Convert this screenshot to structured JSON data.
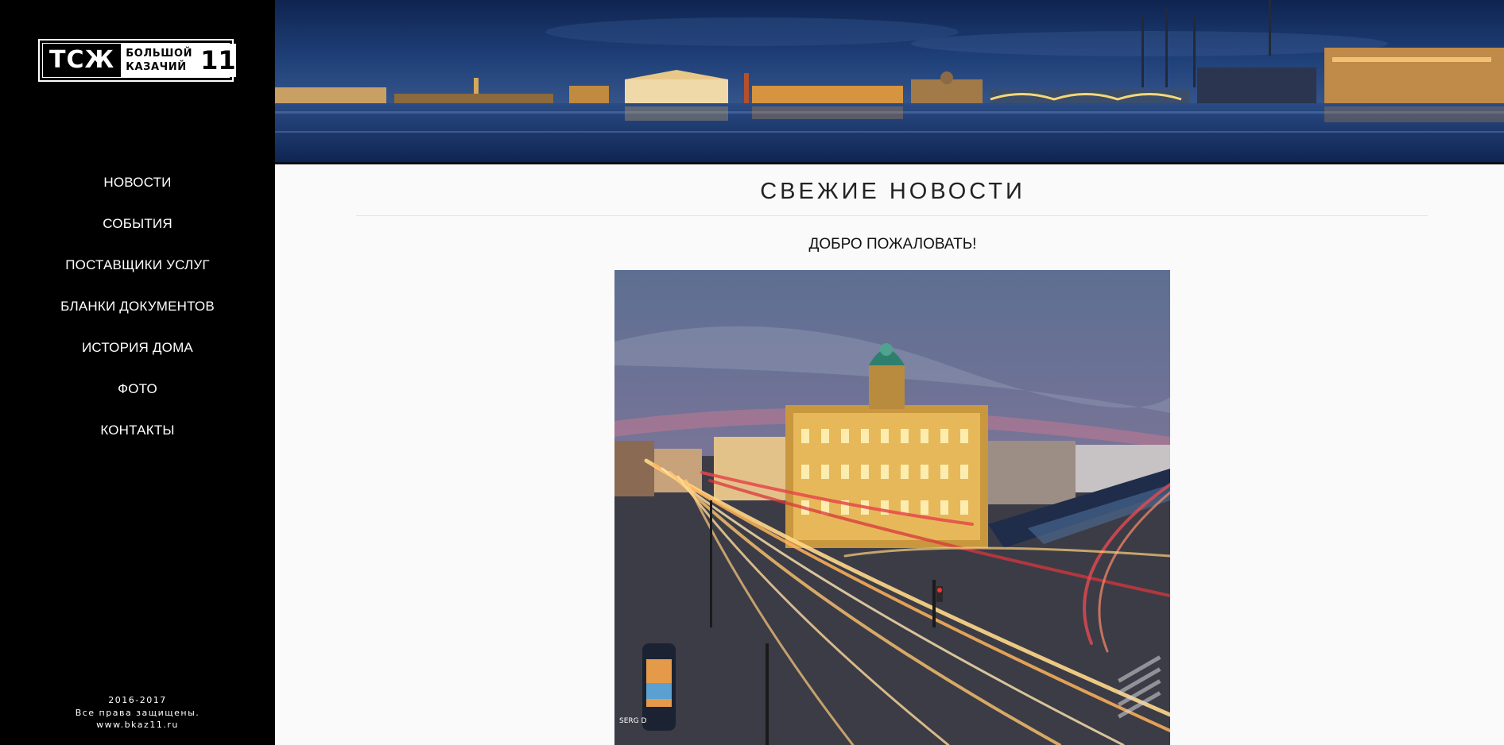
{
  "sidebar": {
    "logo": {
      "abbr": "ТСЖ",
      "line1": "БОЛЬШОЙ",
      "line2": "КАЗАЧИЙ",
      "number": "11"
    },
    "nav": [
      {
        "label": "НОВОСТИ"
      },
      {
        "label": "СОБЫТИЯ"
      },
      {
        "label": "ПОСТАВЩИКИ УСЛУГ"
      },
      {
        "label": "БЛАНКИ ДОКУМЕНТОВ"
      },
      {
        "label": "ИСТОРИЯ ДОМА"
      },
      {
        "label": "ФОТО"
      },
      {
        "label": "КОНТАКТЫ"
      }
    ],
    "footer": {
      "years": "2016-2017",
      "rights": "Все права защищены.",
      "site": "www.bkaz11.ru"
    }
  },
  "main": {
    "section_title": "СВЕЖИЕ НОВОСТИ",
    "post": {
      "title": "ДОБРО ПОЖАЛОВАТЬ!",
      "watermark": "SERG D"
    }
  },
  "colors": {
    "sidebar_bg": "#000000",
    "page_bg": "#fafafa",
    "banner_sky": "#1c3a6e",
    "city_lights": "#f2b24a"
  }
}
